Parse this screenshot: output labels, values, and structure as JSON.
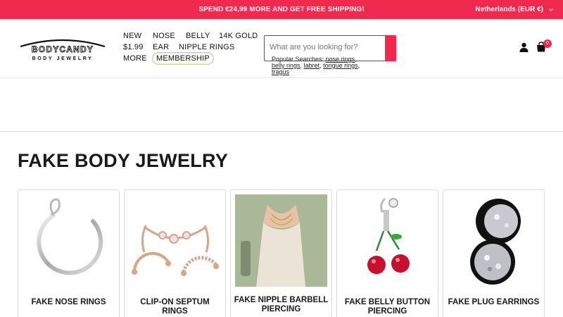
{
  "promo": {
    "text": "SPEND €24,99 MORE AND GET FREE SHIPPING!",
    "region": "Netherlands (EUR €)"
  },
  "brand": {
    "logo_top": "BODYCANDY",
    "logo_bottom": "BODY JEWELRY",
    "accent": "#f0294f"
  },
  "nav": {
    "new": "NEW",
    "nose": "NOSE",
    "belly": "BELLY",
    "gold": "14K GOLD",
    "price": "$1.99",
    "ear": "EAR",
    "nipple": "NIPPLE RINGS",
    "more": "MORE",
    "membership": "MEMBERSHIP"
  },
  "search": {
    "placeholder": "What are you looking for?",
    "popular_label": "Popular Searches:",
    "popular_terms": [
      "nose rings",
      "belly rings",
      "labret",
      "tongue rings",
      "tragus"
    ]
  },
  "cart": {
    "count": "0"
  },
  "page": {
    "title": "FAKE BODY JEWELRY"
  },
  "products": [
    {
      "name": "FAKE NOSE RINGS",
      "icon": "nose-ring-image"
    },
    {
      "name": "CLIP-ON SEPTUM RINGS",
      "icon": "septum-ring-image"
    },
    {
      "name": "FAKE NIPPLE BARBELL PIERCING",
      "icon": "nipple-barbell-photo"
    },
    {
      "name": "FAKE BELLY BUTTON PIERCING",
      "icon": "cherry-belly-ring-image"
    },
    {
      "name": "FAKE PLUG EARRINGS",
      "icon": "plug-earrings-image"
    }
  ]
}
